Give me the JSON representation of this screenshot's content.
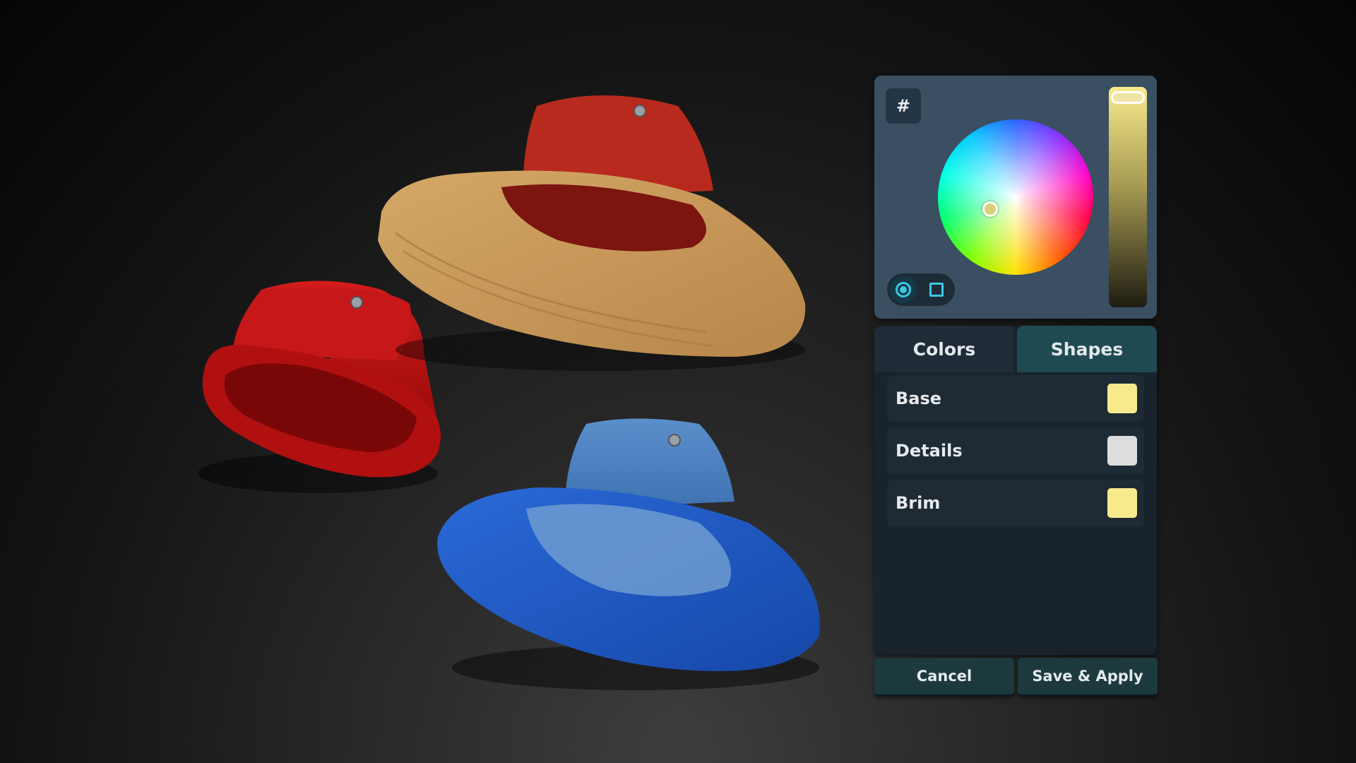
{
  "scene": {
    "items": [
      {
        "name": "bucket-hat-red",
        "crown_color": "#c41414",
        "brim_color": "#b81212"
      },
      {
        "name": "bucket-hat-tan",
        "crown_color": "#b5271b",
        "brim_color": "#c99a5a"
      },
      {
        "name": "bucket-hat-blue",
        "crown_color": "#4a82c4",
        "brim_color": "#1e5bc8"
      }
    ]
  },
  "color_picker": {
    "hex_button_label": "#",
    "selected_color": "#f5ec8f",
    "shape_options": [
      "circle-icon",
      "square-icon"
    ],
    "selected_shape": "circle"
  },
  "tabs": [
    {
      "label": "Colors",
      "active": false
    },
    {
      "label": "Shapes",
      "active": true
    }
  ],
  "properties": [
    {
      "label": "Base",
      "color": "#f6ea8d"
    },
    {
      "label": "Details",
      "color": "#dddddd"
    },
    {
      "label": "Brim",
      "color": "#f6ea8d"
    }
  ],
  "buttons": {
    "cancel_label": "Cancel",
    "save_label": "Save & Apply"
  }
}
